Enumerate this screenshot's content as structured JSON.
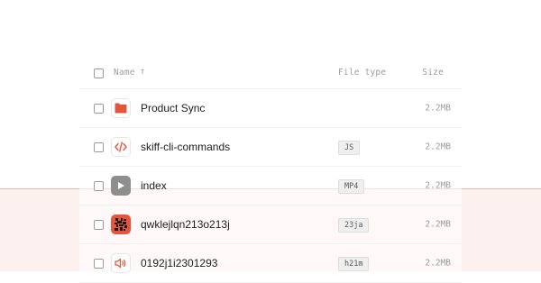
{
  "table": {
    "headers": {
      "name": "Name",
      "sort_arrow": "↑",
      "file_type": "File type",
      "size": "Size"
    },
    "rows": [
      {
        "name": "Product Sync",
        "icon": "folder-icon",
        "type": "",
        "size": "2.2MB"
      },
      {
        "name": "skiff-cli-commands",
        "icon": "code-icon",
        "type": "JS",
        "size": "2.2MB"
      },
      {
        "name": "index",
        "icon": "video-play-icon",
        "type": "MP4",
        "size": "2.2MB"
      },
      {
        "name": "qwklejlqn213o213j",
        "icon": "image-icon",
        "type": "23ja",
        "size": "2.2MB"
      },
      {
        "name": "0192j1i2301293",
        "icon": "audio-icon",
        "type": "h21m",
        "size": "2.2MB"
      }
    ]
  },
  "colors": {
    "accent": "#e5553d",
    "highlight_band": "#fdf1ef",
    "video_icon": "#8e8e8e"
  }
}
